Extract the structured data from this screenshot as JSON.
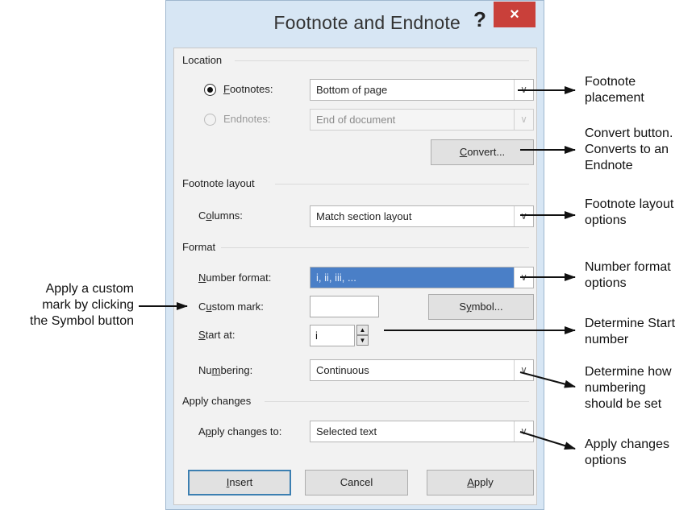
{
  "dialog": {
    "title": "Footnote and Endnote",
    "help_glyph": "?",
    "close_glyph": "×"
  },
  "location": {
    "group_title": "Location",
    "footnotes": {
      "label_pre": "",
      "label_key": "F",
      "label_post": "ootnotes:",
      "value": "Bottom of page",
      "checked": true
    },
    "endnotes": {
      "label": "Endnotes:",
      "value": "End of document",
      "checked": false
    },
    "convert_button": {
      "key": "C",
      "rest": "onvert..."
    }
  },
  "footnote_layout": {
    "group_title": "Footnote layout",
    "columns": {
      "label_pre": "C",
      "label_key": "o",
      "label_post": "lumns:",
      "value": "Match section layout"
    }
  },
  "format": {
    "group_title": "Format",
    "number_format": {
      "label_key": "N",
      "label_post": "umber format:",
      "value": "i, ii, iii, ..."
    },
    "custom_mark": {
      "label_pre": "C",
      "label_key": "u",
      "label_post": "stom mark:",
      "value": ""
    },
    "symbol_button": {
      "pre": "S",
      "key": "y",
      "post": "mbol..."
    },
    "start_at": {
      "label_key": "S",
      "label_post": "tart at:",
      "value": "i"
    },
    "numbering": {
      "label_pre": "Nu",
      "label_key": "m",
      "label_post": "bering:",
      "value": "Continuous"
    }
  },
  "apply_changes": {
    "group_title": "Apply changes",
    "apply_to": {
      "label_pre": "A",
      "label_key": "p",
      "label_post": "ply changes to:",
      "value": "Selected text"
    }
  },
  "buttons": {
    "insert": {
      "key": "I",
      "rest": "nsert"
    },
    "cancel": "Cancel",
    "apply": {
      "key": "A",
      "rest": "pply"
    }
  },
  "annotations": {
    "footnote_placement": [
      "Footnote",
      "placement"
    ],
    "convert": [
      "Convert button.",
      "Converts to an",
      "Endnote"
    ],
    "layout": [
      "Footnote layout",
      "options"
    ],
    "number_format": [
      "Number format",
      "options"
    ],
    "custom_mark": [
      "Apply a custom",
      "mark by clicking",
      "the Symbol button"
    ],
    "start_number": [
      "Determine Start",
      "number"
    ],
    "numbering": [
      "Determine how",
      "numbering",
      "should be set"
    ],
    "apply_changes": [
      "Apply changes",
      "options"
    ]
  },
  "colors": {
    "dialog_frame": "#d7e6f4",
    "close_button": "#c9403a",
    "selection_highlight": "#4a7fc7",
    "default_button_border": "#3c7fb1"
  },
  "icons": {
    "dropdown": "chevron-down-icon",
    "spinner_up": "triangle-up-icon",
    "spinner_down": "triangle-down-icon",
    "arrow": "arrow-left-icon"
  }
}
